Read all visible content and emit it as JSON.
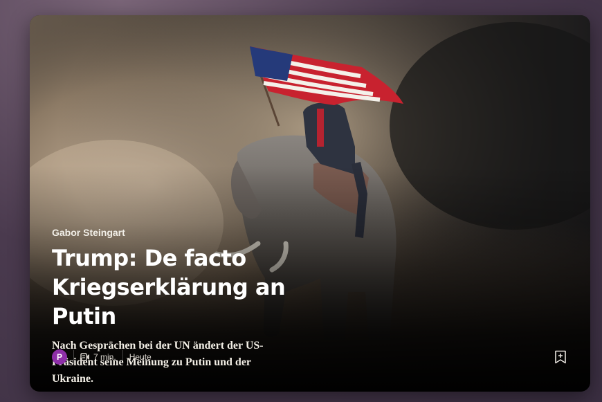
{
  "card": {
    "author": "Gabor Steingart",
    "headline": "Trump: De facto Kriegserklärung an Putin",
    "excerpt": "Nach Gesprächen bei der UN ändert der US-Präsident seine Meinung zu Putin und der Ukraine.",
    "publisher_logo_letter": "P",
    "read_time": "7 min.",
    "date": "Heute"
  },
  "icons": {
    "read_time": "read-time-icon",
    "bookmark": "bookmark-add-icon",
    "publisher": "publisher-logo"
  },
  "colors": {
    "publisher_logo": "#8e2fa8",
    "background": "#3b2f42"
  }
}
